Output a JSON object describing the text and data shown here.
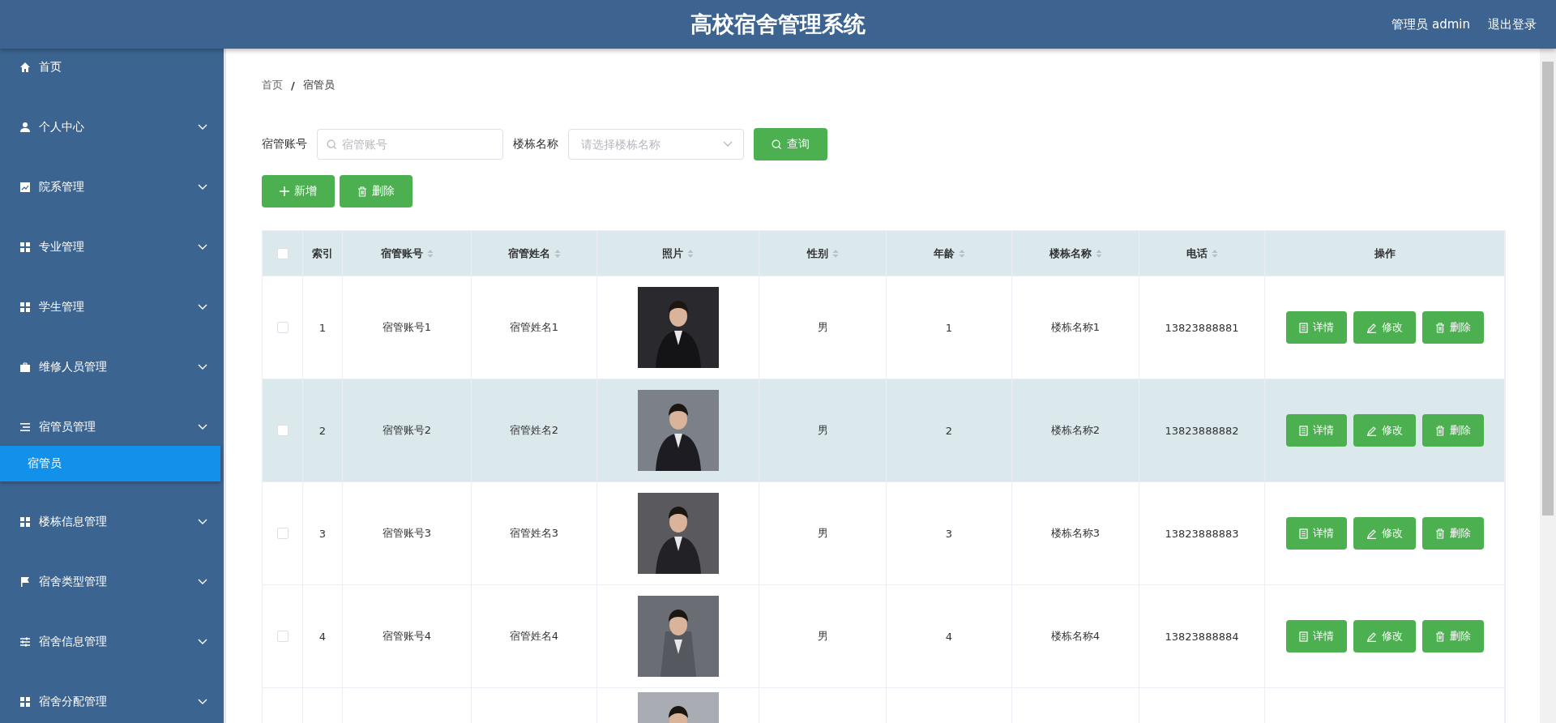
{
  "header": {
    "title": "高校宿舍管理系统",
    "user": "管理员 admin",
    "logout": "退出登录"
  },
  "sidebar": {
    "items": [
      {
        "label": "首页",
        "expandable": false
      },
      {
        "label": "个人中心",
        "expandable": true
      },
      {
        "label": "院系管理",
        "expandable": true
      },
      {
        "label": "专业管理",
        "expandable": true
      },
      {
        "label": "学生管理",
        "expandable": true
      },
      {
        "label": "维修人员管理",
        "expandable": true
      },
      {
        "label": "宿管员管理",
        "expandable": true,
        "expanded": true,
        "children": [
          {
            "label": "宿管员",
            "selected": true
          }
        ]
      },
      {
        "label": "楼栋信息管理",
        "expandable": true
      },
      {
        "label": "宿舍类型管理",
        "expandable": true
      },
      {
        "label": "宿舍信息管理",
        "expandable": true
      },
      {
        "label": "宿舍分配管理",
        "expandable": true
      }
    ]
  },
  "breadcrumb": {
    "items": [
      "首页",
      "宿管员"
    ],
    "separator": "/"
  },
  "search": {
    "fields": [
      {
        "label": "宿管账号",
        "kind": "text",
        "placeholder": "宿管账号"
      },
      {
        "label": "楼栋名称",
        "kind": "select",
        "placeholder": "请选择楼栋名称"
      }
    ],
    "button": "查询"
  },
  "actions": [
    "新增",
    "删除"
  ],
  "table": {
    "columns": [
      {
        "label": "索引",
        "sortable": false
      },
      {
        "label": "宿管账号",
        "sortable": true
      },
      {
        "label": "宿管姓名",
        "sortable": true
      },
      {
        "label": "照片",
        "sortable": true
      },
      {
        "label": "性别",
        "sortable": true
      },
      {
        "label": "年龄",
        "sortable": true
      },
      {
        "label": "楼栋名称",
        "sortable": true
      },
      {
        "label": "电话",
        "sortable": true
      },
      {
        "label": "操作",
        "sortable": false
      }
    ],
    "header_checked": false,
    "rows": [
      {
        "index": "1",
        "account": "宿管账号1",
        "name": "宿管姓名1",
        "gender": "男",
        "age": "1",
        "building": "楼栋名称1",
        "phone": "13823888881",
        "checked": false,
        "highlighted": false,
        "buttons": [
          "详情",
          "修改",
          "删除"
        ]
      },
      {
        "index": "2",
        "account": "宿管账号2",
        "name": "宿管姓名2",
        "gender": "男",
        "age": "2",
        "building": "楼栋名称2",
        "phone": "13823888882",
        "checked": false,
        "highlighted": true,
        "buttons": [
          "详情",
          "修改",
          "删除"
        ]
      },
      {
        "index": "3",
        "account": "宿管账号3",
        "name": "宿管姓名3",
        "gender": "男",
        "age": "3",
        "building": "楼栋名称3",
        "phone": "13823888883",
        "checked": false,
        "highlighted": false,
        "buttons": [
          "详情",
          "修改",
          "删除"
        ]
      },
      {
        "index": "4",
        "account": "宿管账号4",
        "name": "宿管姓名4",
        "gender": "男",
        "age": "4",
        "building": "楼栋名称4",
        "phone": "13823888884",
        "checked": false,
        "highlighted": false,
        "buttons": [
          "详情",
          "修改",
          "删除"
        ]
      },
      {
        "cut_off": true
      }
    ]
  }
}
